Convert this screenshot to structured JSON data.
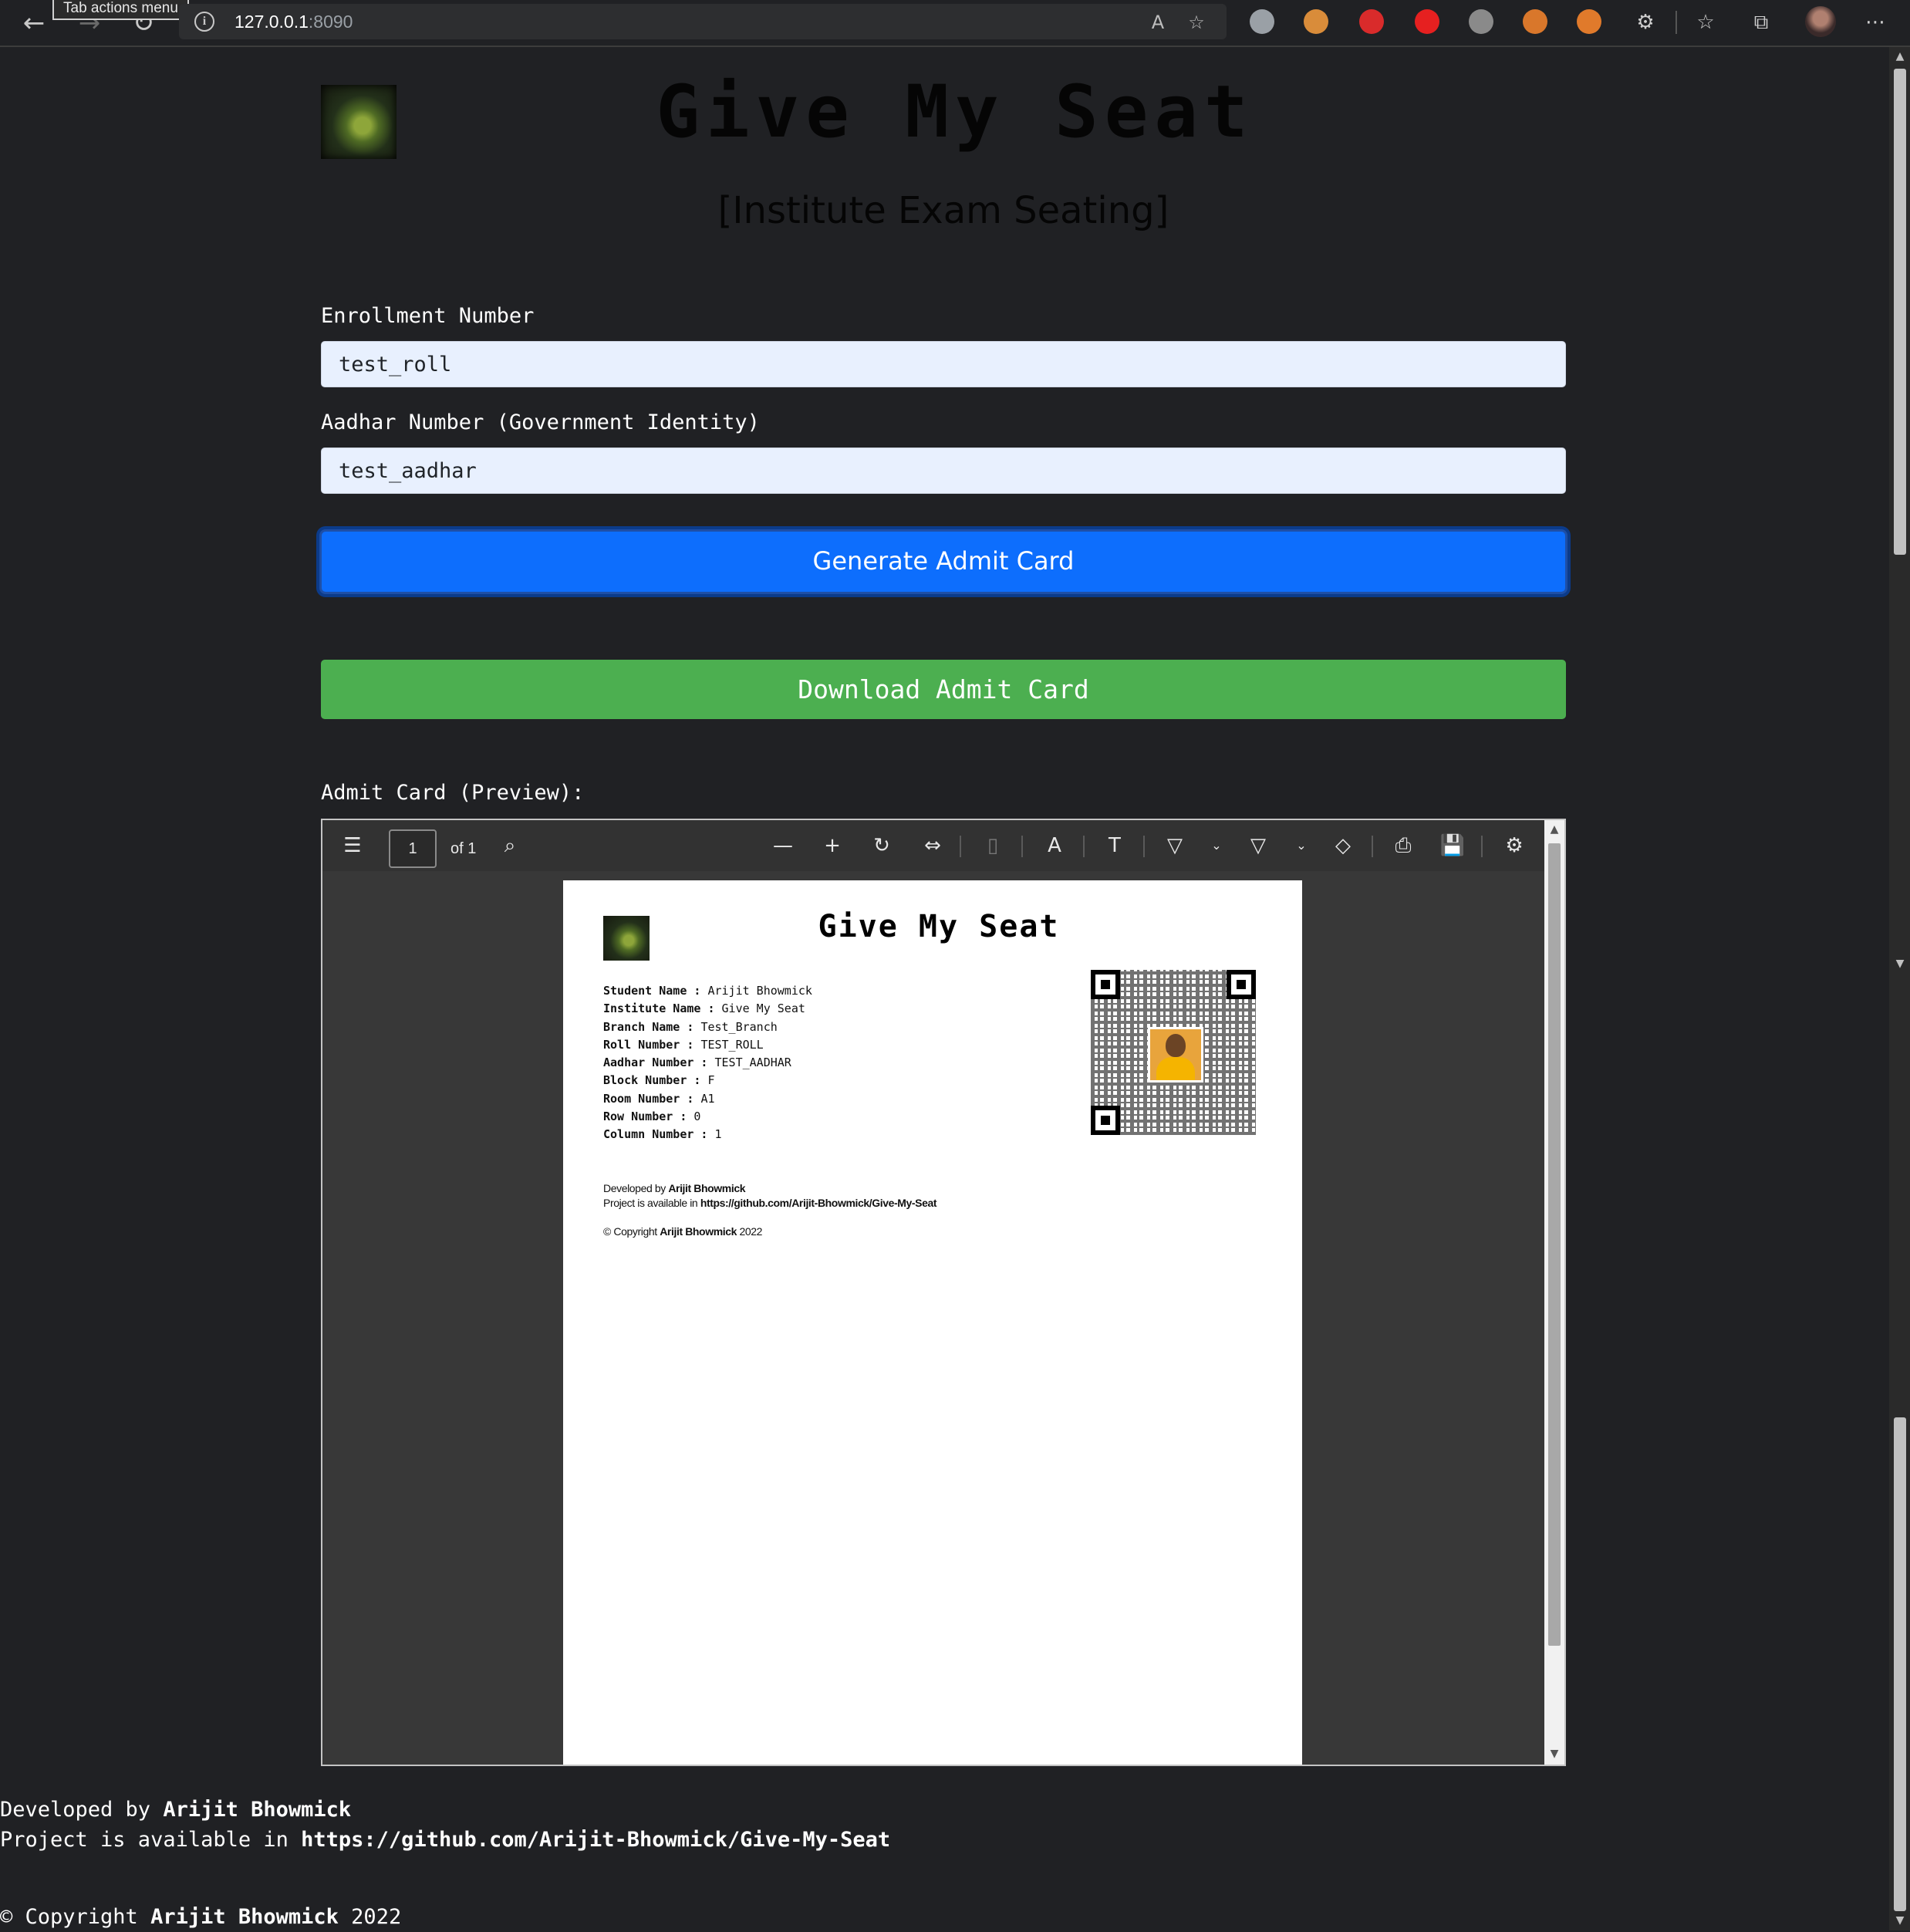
{
  "browser": {
    "tooltip": "Tab actions menu",
    "url_host": "127.0.0.1",
    "url_port": ":8090",
    "nav": {
      "back_icon": "←",
      "forward_icon": "→",
      "reload_icon": "↻"
    },
    "address_icons": {
      "info_icon": "i",
      "read_aloud_icon": "A",
      "favorite_add_icon": "☆"
    },
    "toolbar_icons": {
      "extensions_icon": "⚙",
      "favorites_icon": "☆",
      "collections_icon": "⧉",
      "more_icon": "⋯"
    },
    "extension_colors": [
      "#9aa0a6",
      "#d98c3a",
      "#d92b2b",
      "#e62020",
      "#8a8a8a",
      "#d9772b",
      "#e07a2b"
    ]
  },
  "header": {
    "title": "Give My Seat",
    "subtitle": "[Institute Exam Seating]"
  },
  "form": {
    "enrollment_label": "Enrollment Number",
    "enrollment_value": "test_roll",
    "aadhar_label": "Aadhar Number (Government Identity)",
    "aadhar_value": "test_aadhar",
    "generate_button": "Generate Admit Card",
    "download_button": "Download Admit Card"
  },
  "preview": {
    "label": "Admit Card (Preview):",
    "toolbar": {
      "page_current": "1",
      "page_total": "of 1",
      "icons": {
        "contents": "☰",
        "search": "⌕",
        "zoom_out": "—",
        "zoom_in": "+",
        "rotate": "↻",
        "fit": "⇔",
        "page_view": "▯",
        "read_aloud": "A",
        "text": "T",
        "draw": "▽",
        "chevron": "⌄",
        "highlight": "▽",
        "erase": "◇",
        "print": "⎙",
        "save": "💾",
        "settings": "⚙"
      }
    },
    "document": {
      "title": "Give My Seat",
      "details": [
        {
          "key": "Student Name",
          "value": "Arijit Bhowmick"
        },
        {
          "key": "Institute Name",
          "value": "Give My Seat"
        },
        {
          "key": "Branch Name",
          "value": "Test_Branch"
        },
        {
          "key": "Roll Number",
          "value": "TEST_ROLL"
        },
        {
          "key": "Aadhar Number",
          "value": "TEST_AADHAR"
        },
        {
          "key": "Block Number",
          "value": "F"
        },
        {
          "key": "Room Number",
          "value": "A1"
        },
        {
          "key": "Row Number",
          "value": "0"
        },
        {
          "key": "Column Number",
          "value": "1"
        }
      ],
      "developed_prefix": "Developed by ",
      "developer": "Arijit Bhowmick",
      "available_prefix": "Project is available in ",
      "repo": "https://github.com/Arijit-Bhowmick/Give-My-Seat",
      "copyright_prefix": "© Copyright ",
      "copyright_name": "Arijit Bhowmick",
      "copyright_year": " 2022"
    }
  },
  "footer": {
    "developed_prefix": "Developed by ",
    "developer": "Arijit Bhowmick",
    "available_prefix": "Project is available in ",
    "repo": "https://github.com/Arijit-Bhowmick/Give-My-Seat",
    "copyright_prefix": "© Copyright ",
    "copyright_name": "Arijit Bhowmick",
    "copyright_year": " 2022"
  }
}
